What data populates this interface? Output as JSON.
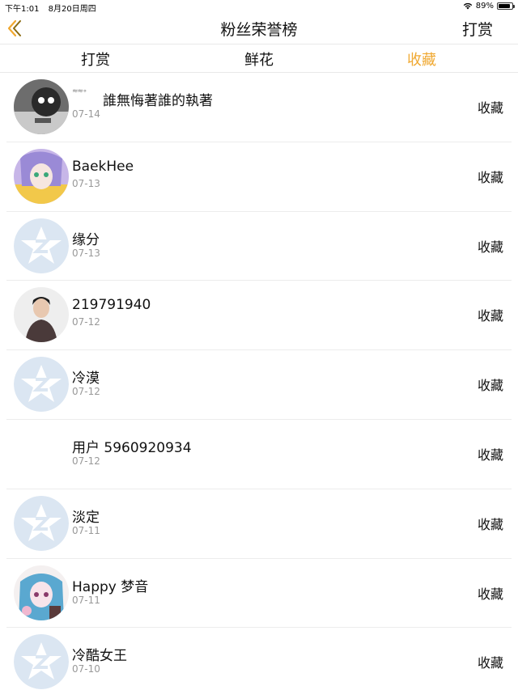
{
  "status": {
    "time": "下午1:01",
    "date": "8月20日周四",
    "battery": "89%",
    "battery_level": 0.89
  },
  "nav": {
    "title": "粉丝荣誉榜",
    "right_label": "打赏",
    "back_icon": "chevron-left-icon"
  },
  "colors": {
    "accent": "#f0a830",
    "default_avatar": "#dbe6f2"
  },
  "tabs": [
    {
      "label": "打赏",
      "active": false
    },
    {
      "label": "鲜花",
      "active": false
    },
    {
      "label": "收藏",
      "active": true
    }
  ],
  "rows": [
    {
      "name": "誰無悔著誰的執著",
      "date": "07-14",
      "action": "收藏",
      "avatar": "custom-dark"
    },
    {
      "name": "BaekHee",
      "date": "07-13",
      "action": "收藏",
      "avatar": "custom-anime"
    },
    {
      "name": "缘分",
      "date": "07-13",
      "action": "收藏",
      "avatar": "default"
    },
    {
      "name": "219791940",
      "date": "07-12",
      "action": "收藏",
      "avatar": "custom-person"
    },
    {
      "name": "冷漠",
      "date": "07-12",
      "action": "收藏",
      "avatar": "default"
    },
    {
      "name": "用户 5960920934",
      "date": "07-12",
      "action": "收藏",
      "avatar": "none"
    },
    {
      "name": "淡定",
      "date": "07-11",
      "action": "收藏",
      "avatar": "default"
    },
    {
      "name": "Happy 梦音",
      "date": "07-11",
      "action": "收藏",
      "avatar": "custom-girl"
    },
    {
      "name": "冷酷女王",
      "date": "07-10",
      "action": "收藏",
      "avatar": "default"
    }
  ]
}
